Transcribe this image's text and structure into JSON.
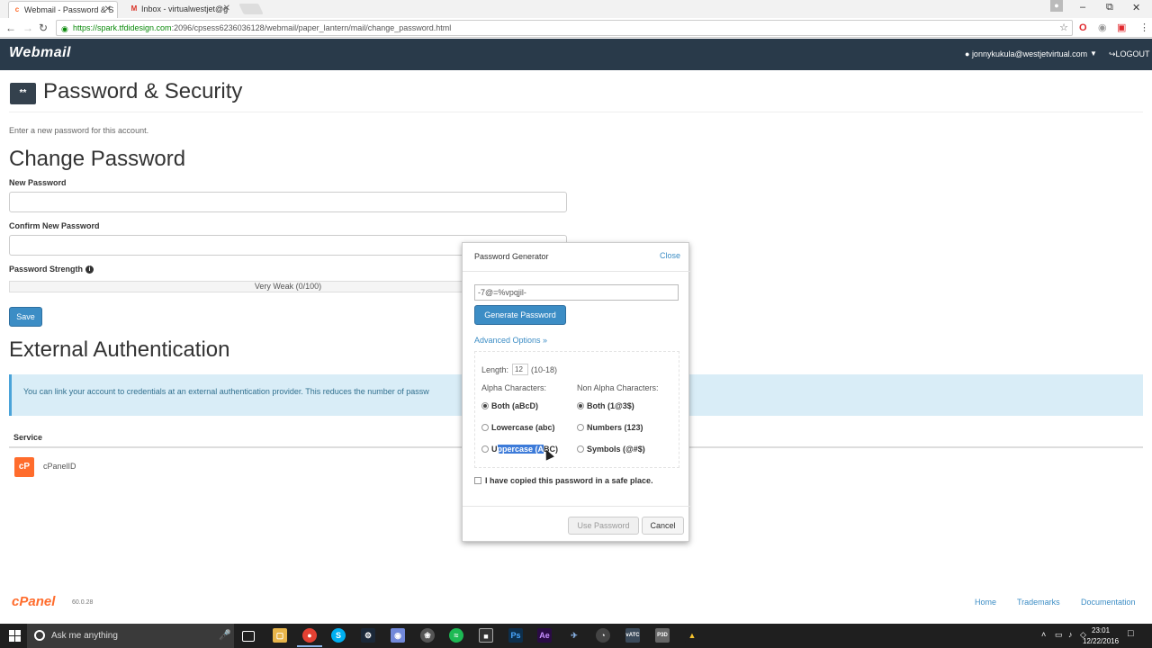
{
  "browser": {
    "tabs": [
      {
        "label": "Webmail - Password & S",
        "favicon": "cpanel-icon"
      },
      {
        "label": "Inbox - virtualwestjet@g",
        "favicon": "gmail-icon"
      }
    ],
    "url_host": "https://spark.tfdidesign.com",
    "url_path": ":2096/cpsess6236036128/webmail/paper_lantern/mail/change_password.html"
  },
  "header": {
    "logo": "Webmail",
    "user": "jonnykukula@westjetvirtual.com",
    "logout": "LOGOUT"
  },
  "page": {
    "title": "Password & Security",
    "icon_text": "**",
    "intro": "Enter a new password for this account.",
    "change_password_heading": "Change Password",
    "new_password_label": "New Password",
    "confirm_password_label": "Confirm New Password",
    "strength_label": "Password Strength",
    "strength_value": "Very Weak (0/100)",
    "strength_percent": 0,
    "save_label": "Save",
    "external_auth_heading": "External Authentication",
    "external_auth_alert": "You can link your account to credentials at an external authentication provider. This reduces the number of passw",
    "service_header": "Service",
    "service_name": "cPanelID"
  },
  "modal": {
    "title": "Password Generator",
    "close": "Close",
    "generated_password": "-7@=%vpqjil-",
    "generate_button": "Generate Password",
    "advanced_link": "Advanced Options »",
    "length_label": "Length:",
    "length_value": "12",
    "length_range": "(10-18)",
    "alpha_heading": "Alpha Characters:",
    "non_alpha_heading": "Non Alpha Characters:",
    "alpha_options": [
      "Both (aBcD)",
      "Lowercase (abc)"
    ],
    "uppercase_prefix": "U",
    "uppercase_selected": "ppercase (A",
    "uppercase_suffix": "BC)",
    "non_alpha_options": [
      "Both (1@3$)",
      "Numbers (123)",
      "Symbols (@#$)"
    ],
    "copied_label": "I have copied this password in a safe place.",
    "use_password": "Use Password",
    "cancel": "Cancel"
  },
  "footer": {
    "logo": "cPanel",
    "version": "60.0.28",
    "links": [
      "Home",
      "Trademarks",
      "Documentation"
    ]
  },
  "taskbar": {
    "search_placeholder": "Ask me anything",
    "time": "23:01",
    "date": "12/22/2016"
  }
}
